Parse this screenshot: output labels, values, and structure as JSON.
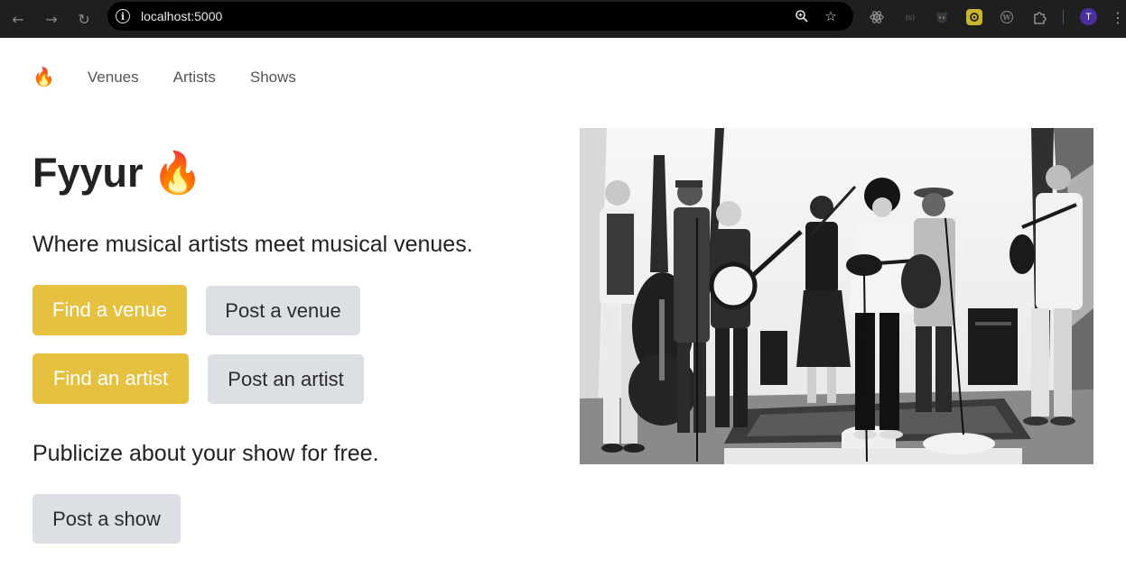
{
  "browser": {
    "url": "localhost:5000",
    "profile_initial": "T",
    "icons": {
      "back": "arrow-left-icon",
      "forward": "arrow-right-icon",
      "reload": "reload-icon",
      "site_info": "info-icon",
      "zoom": "zoom-icon",
      "bookmark": "star-icon",
      "menu": "more-vert-icon"
    }
  },
  "nav": {
    "brand": "🔥",
    "links": [
      "Venues",
      "Artists",
      "Shows"
    ]
  },
  "hero": {
    "title": "Fyyur",
    "title_icon": "🔥",
    "lead": "Where musical artists meet musical venues.",
    "buttons": {
      "find_venue": "Find a venue",
      "post_venue": "Post a venue",
      "find_artist": "Find an artist",
      "post_artist": "Post an artist"
    },
    "show_lead": "Publicize about your show for free.",
    "post_show": "Post a show"
  },
  "colors": {
    "primary_button": "#e6c13f",
    "secondary_button": "#dcdfe3",
    "brand_flame": "#e2541f"
  }
}
